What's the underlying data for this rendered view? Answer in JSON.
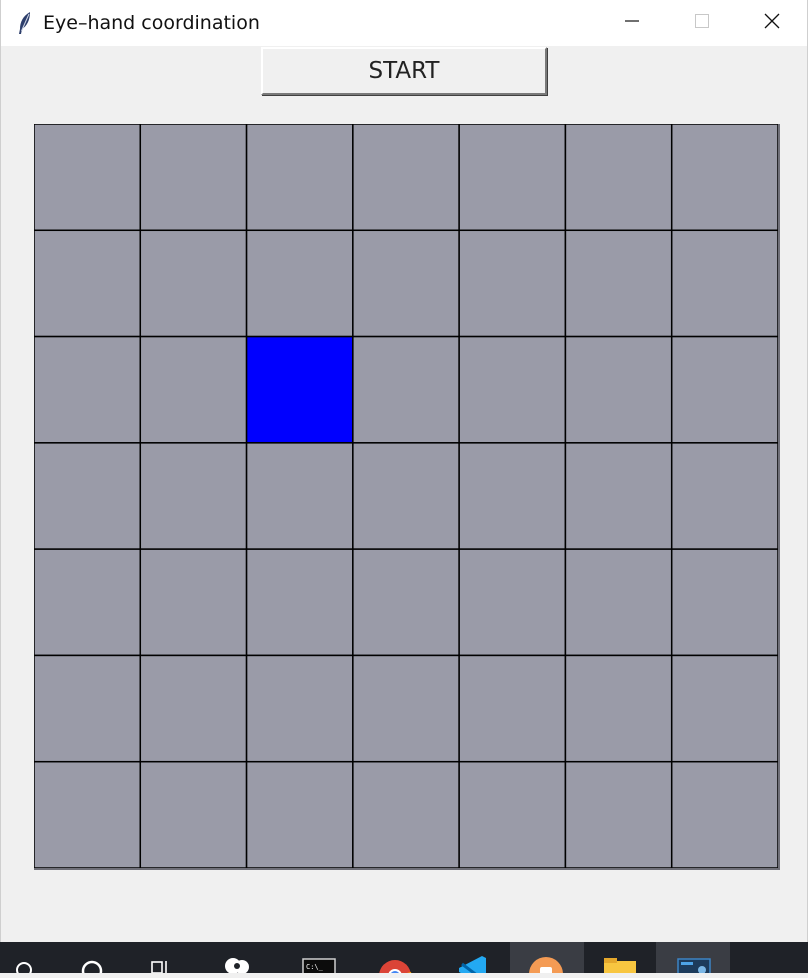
{
  "window": {
    "title": "Eye–hand coordination",
    "icon": "feather-icon",
    "controls": [
      "minimize-icon",
      "maximize-icon",
      "close-icon"
    ]
  },
  "toolbar": {
    "start_label": "START"
  },
  "board": {
    "rows": 7,
    "cols": 7,
    "cell_color": "#9a9ba8",
    "line_color": "#000000",
    "target": {
      "row": 2,
      "col": 2,
      "color": "#0000ff"
    }
  },
  "taskbar": {
    "items": [
      "start-icon",
      "search-icon",
      "task-view-icon",
      "chat-icon",
      "terminal-icon",
      "chrome-icon",
      "vscode-icon",
      "store-icon",
      "file-explorer-icon",
      "python-editor-icon"
    ]
  }
}
